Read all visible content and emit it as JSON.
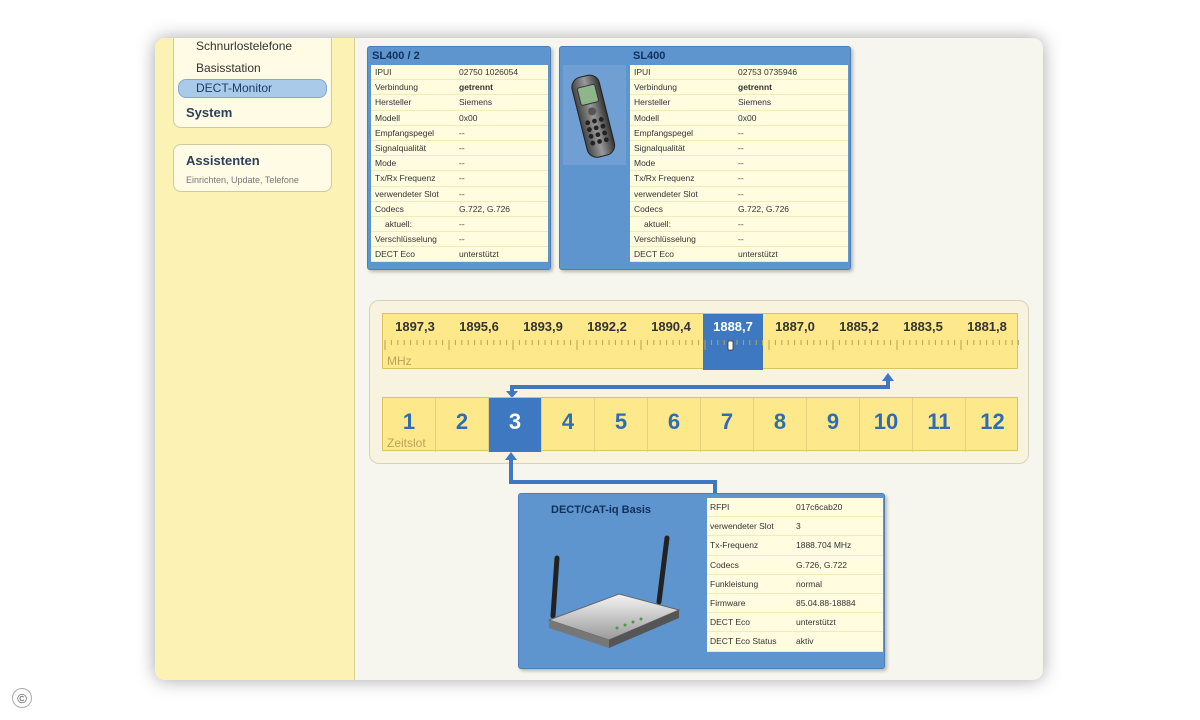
{
  "sidebar": {
    "items": [
      {
        "label": "Schnurlostelefone"
      },
      {
        "label": "Basisstation"
      },
      {
        "label": "DECT-Monitor"
      }
    ],
    "system_label": "System",
    "assistants": {
      "title": "Assistenten",
      "subtitle": "Einrichten, Update, Telefone"
    }
  },
  "handsets": [
    {
      "title": "SL400 / 2",
      "rows": [
        {
          "k": "IPUI",
          "v": "02750 1026054"
        },
        {
          "k": "Verbindung",
          "v": "getrennt"
        },
        {
          "k": "Hersteller",
          "v": "Siemens"
        },
        {
          "k": "Modell",
          "v": "0x00"
        },
        {
          "k": "Empfangspegel",
          "v": "--"
        },
        {
          "k": "Signalqualität",
          "v": "--"
        },
        {
          "k": "Mode",
          "v": "--"
        },
        {
          "k": "Tx/Rx Frequenz",
          "v": "--"
        },
        {
          "k": "verwendeter Slot",
          "v": "--"
        },
        {
          "k": "Codecs",
          "v": "G.722, G.726"
        },
        {
          "k": "aktuell:",
          "v": "--"
        },
        {
          "k": "Verschlüsselung",
          "v": "--"
        },
        {
          "k": "DECT Eco",
          "v": "unterstützt"
        }
      ]
    },
    {
      "title": "SL400",
      "rows": [
        {
          "k": "IPUI",
          "v": "02753 0735946"
        },
        {
          "k": "Verbindung",
          "v": "getrennt"
        },
        {
          "k": "Hersteller",
          "v": "Siemens"
        },
        {
          "k": "Modell",
          "v": "0x00"
        },
        {
          "k": "Empfangspegel",
          "v": "--"
        },
        {
          "k": "Signalqualität",
          "v": "--"
        },
        {
          "k": "Mode",
          "v": "--"
        },
        {
          "k": "Tx/Rx Frequenz",
          "v": "--"
        },
        {
          "k": "verwendeter Slot",
          "v": "--"
        },
        {
          "k": "Codecs",
          "v": "G.722, G.726"
        },
        {
          "k": "aktuell:",
          "v": "--"
        },
        {
          "k": "Verschlüsselung",
          "v": "--"
        },
        {
          "k": "DECT Eco",
          "v": "unterstützt"
        }
      ]
    }
  ],
  "frequency": {
    "unit": "MHz",
    "values": [
      "1897,3",
      "1895,6",
      "1893,9",
      "1892,2",
      "1890,4",
      "1888,7",
      "1887,0",
      "1885,2",
      "1883,5",
      "1881,8"
    ],
    "selected": "1888,7"
  },
  "timeslots": {
    "label": "Zeitslot",
    "values": [
      "1",
      "2",
      "3",
      "4",
      "5",
      "6",
      "7",
      "8",
      "9",
      "10",
      "11",
      "12"
    ],
    "selected": "3"
  },
  "base": {
    "title": "DECT/CAT-iq Basis",
    "rows": [
      {
        "k": "RFPI",
        "v": "017c6cab20"
      },
      {
        "k": "verwendeter Slot",
        "v": "3"
      },
      {
        "k": "Tx-Frequenz",
        "v": "1888.704 MHz"
      },
      {
        "k": "Codecs",
        "v": "G.726, G.722"
      },
      {
        "k": "Funkleistung",
        "v": "normal"
      },
      {
        "k": "Firmware",
        "v": "85.04.88-18884"
      },
      {
        "k": "DECT Eco",
        "v": "unterstützt"
      },
      {
        "k": "DECT Eco Status",
        "v": "aktiv"
      }
    ]
  },
  "copyright": "©",
  "colors": {
    "accent": "#3d78c0",
    "panel_blue": "#5e95cf",
    "sidebar_yellow": "#fbf2b4",
    "ruler_yellow": "#fde98c"
  }
}
